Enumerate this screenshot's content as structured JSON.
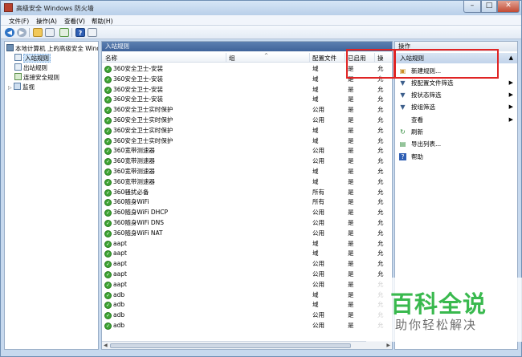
{
  "window": {
    "title": "高级安全 Windows 防火墙",
    "controls": [
      "–",
      "□",
      "✕"
    ]
  },
  "menu": [
    "文件(F)",
    "操作(A)",
    "查看(V)",
    "帮助(H)"
  ],
  "toolbar": {
    "back": "◀",
    "forward": "▶",
    "help": "?"
  },
  "tree": {
    "root": "本地计算机 上的高级安全 Windo",
    "items": [
      {
        "label": "入站规则",
        "selected": true
      },
      {
        "label": "出站规则"
      },
      {
        "label": "连接安全规则"
      },
      {
        "label": "监视",
        "expandable": true
      }
    ]
  },
  "center": {
    "title": "入站规则",
    "columns": [
      "名称",
      "组",
      "配置文件",
      "已启用",
      "操"
    ],
    "rows": [
      {
        "name": "360安全卫士-安装",
        "profile": "域",
        "enabled": "是",
        "action": "允"
      },
      {
        "name": "360安全卫士-安装",
        "profile": "域",
        "enabled": "是",
        "action": "允"
      },
      {
        "name": "360安全卫士-安装",
        "profile": "域",
        "enabled": "是",
        "action": "允"
      },
      {
        "name": "360安全卫士-安装",
        "profile": "域",
        "enabled": "是",
        "action": "允"
      },
      {
        "name": "360安全卫士实时保护",
        "profile": "公用",
        "enabled": "是",
        "action": "允"
      },
      {
        "name": "360安全卫士实时保护",
        "profile": "公用",
        "enabled": "是",
        "action": "允"
      },
      {
        "name": "360安全卫士实时保护",
        "profile": "域",
        "enabled": "是",
        "action": "允"
      },
      {
        "name": "360安全卫士实时保护",
        "profile": "域",
        "enabled": "是",
        "action": "允"
      },
      {
        "name": "360宽带测速器",
        "profile": "公用",
        "enabled": "是",
        "action": "允"
      },
      {
        "name": "360宽带测速器",
        "profile": "公用",
        "enabled": "是",
        "action": "允"
      },
      {
        "name": "360宽带测速器",
        "profile": "域",
        "enabled": "是",
        "action": "允"
      },
      {
        "name": "360宽带测速器",
        "profile": "域",
        "enabled": "是",
        "action": "允"
      },
      {
        "name": "360骚扰必备",
        "profile": "所有",
        "enabled": "是",
        "action": "允"
      },
      {
        "name": "360随身WiFi",
        "profile": "所有",
        "enabled": "是",
        "action": "允"
      },
      {
        "name": "360随身WiFi DHCP",
        "profile": "公用",
        "enabled": "是",
        "action": "允"
      },
      {
        "name": "360随身WiFi DNS",
        "profile": "公用",
        "enabled": "是",
        "action": "允"
      },
      {
        "name": "360随身WiFi NAT",
        "profile": "公用",
        "enabled": "是",
        "action": "允"
      },
      {
        "name": "aapt",
        "profile": "域",
        "enabled": "是",
        "action": "允"
      },
      {
        "name": "aapt",
        "profile": "域",
        "enabled": "是",
        "action": "允"
      },
      {
        "name": "aapt",
        "profile": "公用",
        "enabled": "是",
        "action": "允"
      },
      {
        "name": "aapt",
        "profile": "公用",
        "enabled": "是",
        "action": "允"
      },
      {
        "name": "aapt",
        "profile": "公用",
        "enabled": "是",
        "action": "允"
      },
      {
        "name": "adb",
        "profile": "域",
        "enabled": "是",
        "action": "允"
      },
      {
        "name": "adb",
        "profile": "域",
        "enabled": "是",
        "action": "允"
      },
      {
        "name": "adb",
        "profile": "公用",
        "enabled": "是",
        "action": "允"
      },
      {
        "name": "adb",
        "profile": "公用",
        "enabled": "是",
        "action": "允"
      }
    ]
  },
  "actions": {
    "title": "操作",
    "group": "入站规则",
    "items": [
      {
        "label": "新建规则...",
        "icon": "new-rule-icon"
      },
      {
        "label": "按配置文件筛选",
        "icon": "filter-icon",
        "submenu": true
      },
      {
        "label": "按状态筛选",
        "icon": "filter-icon",
        "submenu": true
      },
      {
        "label": "按组筛选",
        "icon": "filter-icon",
        "submenu": true
      },
      {
        "label": "查看",
        "icon": "",
        "submenu": true
      },
      {
        "label": "刷新",
        "icon": "refresh-icon"
      },
      {
        "label": "导出列表...",
        "icon": "export-icon"
      },
      {
        "label": "帮助",
        "icon": "help-icon"
      }
    ]
  },
  "watermark": {
    "main": "百科全说",
    "sub": "助你轻松解决"
  }
}
